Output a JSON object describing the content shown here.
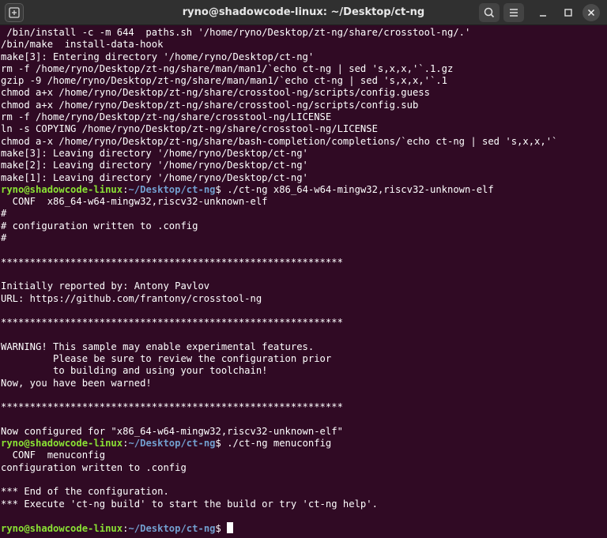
{
  "window": {
    "title": "ryno@shadowcode-linux: ~/Desktop/ct-ng"
  },
  "titlebar": {
    "new_tab_icon": "new-tab-icon",
    "search_icon": "search-icon",
    "menu_icon": "hamburger-menu-icon",
    "minimize_icon": "minimize-icon",
    "maximize_icon": "maximize-icon",
    "close_icon": "close-icon"
  },
  "prompt": {
    "user": "ryno@shadowcode-linux",
    "sep": ":",
    "path": "~/Desktop/ct-ng",
    "dollar": "$ "
  },
  "colors": {
    "background": "#300a24",
    "user": "#8ae234",
    "path": "#729fcf",
    "text": "#ffffff"
  },
  "terminal": {
    "lines": [
      " /bin/install -c -m 644  paths.sh '/home/ryno/Desktop/zt-ng/share/crosstool-ng/.'",
      "/bin/make  install-data-hook",
      "make[3]: Entering directory '/home/ryno/Desktop/ct-ng'",
      "rm -f /home/ryno/Desktop/zt-ng/share/man/man1/`echo ct-ng | sed 's,x,x,'`.1.gz",
      "gzip -9 /home/ryno/Desktop/zt-ng/share/man/man1/`echo ct-ng | sed 's,x,x,'`.1",
      "chmod a+x /home/ryno/Desktop/zt-ng/share/crosstool-ng/scripts/config.guess",
      "chmod a+x /home/ryno/Desktop/zt-ng/share/crosstool-ng/scripts/config.sub",
      "rm -f /home/ryno/Desktop/zt-ng/share/crosstool-ng/LICENSE",
      "ln -s COPYING /home/ryno/Desktop/zt-ng/share/crosstool-ng/LICENSE",
      "chmod a-x /home/ryno/Desktop/zt-ng/share/bash-completion/completions/`echo ct-ng | sed 's,x,x,'`",
      "make[3]: Leaving directory '/home/ryno/Desktop/ct-ng'",
      "make[2]: Leaving directory '/home/ryno/Desktop/ct-ng'",
      "make[1]: Leaving directory '/home/ryno/Desktop/ct-ng'",
      "./ct-ng x86_64-w64-mingw32,riscv32-unknown-elf",
      "  CONF  x86_64-w64-mingw32,riscv32-unknown-elf",
      "#",
      "# configuration written to .config",
      "#",
      "",
      "***********************************************************",
      "",
      "Initially reported by: Antony Pavlov",
      "URL: https://github.com/frantony/crosstool-ng",
      "",
      "***********************************************************",
      "",
      "WARNING! This sample may enable experimental features.",
      "         Please be sure to review the configuration prior",
      "         to building and using your toolchain!",
      "Now, you have been warned!",
      "",
      "***********************************************************",
      "",
      "Now configured for \"x86_64-w64-mingw32,riscv32-unknown-elf\"",
      "./ct-ng menuconfig",
      "  CONF  menuconfig",
      "configuration written to .config",
      "",
      "*** End of the configuration.",
      "*** Execute 'ct-ng build' to start the build or try 'ct-ng help'.",
      "",
      ""
    ]
  }
}
